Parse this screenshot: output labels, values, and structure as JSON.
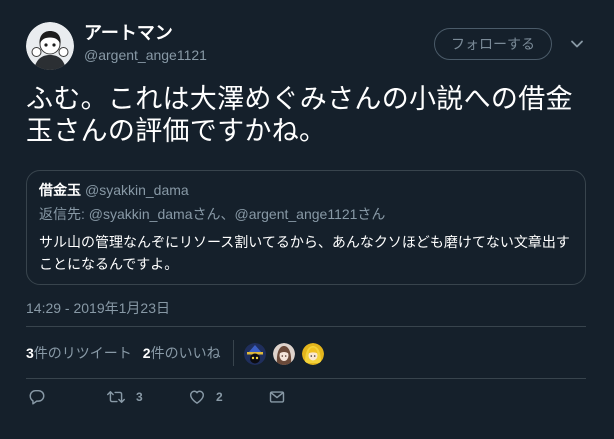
{
  "theme": {
    "background": "#15202b",
    "text_primary": "#ffffff",
    "text_secondary": "#8899a6",
    "border": "#38444d"
  },
  "author": {
    "avatar_icon": "user-avatar",
    "display_name": "アートマン",
    "handle": "@argent_ange1121"
  },
  "header": {
    "follow_button_label": "フォローする",
    "menu_icon": "chevron-down-icon"
  },
  "tweet": {
    "text": "ふむ。これは大澤めぐみさんの小説への借金玉さんの評価ですかね。"
  },
  "quoted_tweet": {
    "author_name": "借金玉",
    "author_handle": "@syakkin_dama",
    "reply_context": "返信先: @syakkin_damaさん、@argent_ange1121さん",
    "text": "サル山の管理なんぞにリソース割いてるから、あんなクソほども磨けてない文章出すことになるんですよ。"
  },
  "timestamp": "14:29 - 2019年1月23日",
  "stats": {
    "retweets": {
      "count": "3",
      "label": "件のリツイート"
    },
    "likes": {
      "count": "2",
      "label": "件のいいね"
    },
    "liker_avatars": [
      "liker-avatar-1",
      "liker-avatar-2",
      "liker-avatar-3"
    ]
  },
  "actions": {
    "reply": {
      "icon": "reply-icon"
    },
    "retweet": {
      "icon": "retweet-icon",
      "count": "3"
    },
    "like": {
      "icon": "heart-icon",
      "count": "2"
    },
    "message": {
      "icon": "envelope-icon"
    }
  }
}
